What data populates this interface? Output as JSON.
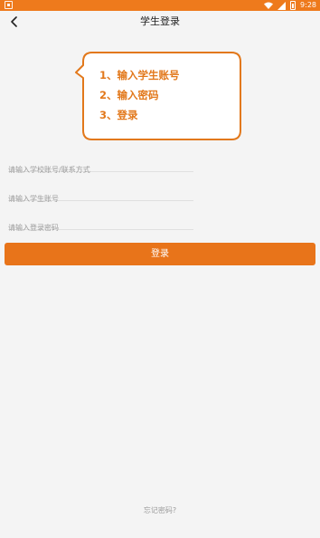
{
  "status_bar": {
    "time": "9:28",
    "accent_color": "#ee7a1c"
  },
  "header": {
    "title": "学生登录",
    "back_icon": "chevron-left-icon"
  },
  "tip": {
    "lines": [
      "1、输入学生账号",
      "2、输入密码",
      "3、登录"
    ],
    "color": "#e2781b"
  },
  "form": {
    "school_account_placeholder": "请输入学校账号/联系方式",
    "student_account_placeholder": "请输入学生账号",
    "password_placeholder": "请输入登录密码",
    "login_label": "登录",
    "button_color": "#e8741a"
  },
  "footer": {
    "forgot_label": "忘记密码?"
  }
}
